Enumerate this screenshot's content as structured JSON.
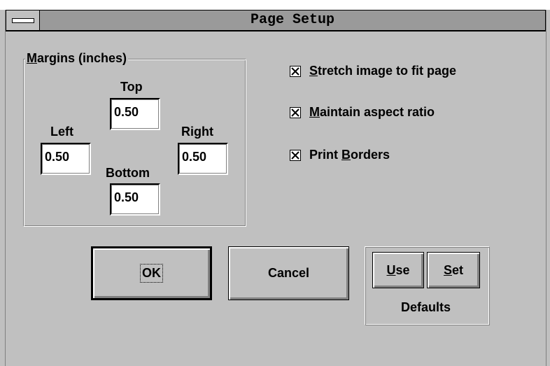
{
  "window": {
    "title": "Page Setup"
  },
  "margins": {
    "group_label": "Margins (inches)",
    "group_label_mnemonic": "M",
    "group_label_rest": "argins (inches)",
    "top": {
      "label": "Top",
      "value": "0.50"
    },
    "left": {
      "label": "Left",
      "value": "0.50"
    },
    "right": {
      "label": "Right",
      "value": "0.50"
    },
    "bottom": {
      "label": "Bottom",
      "value": "0.50"
    }
  },
  "options": [
    {
      "mnemonic": "S",
      "rest": "tretch image to fit page",
      "prefix": "",
      "checked": true
    },
    {
      "mnemonic": "M",
      "rest": "aintain aspect ratio",
      "prefix": "",
      "checked": true
    },
    {
      "mnemonic": "B",
      "rest": "orders",
      "prefix": "Print ",
      "checked": true
    }
  ],
  "buttons": {
    "ok": "OK",
    "cancel": "Cancel",
    "use_mnemonic": "U",
    "use_rest": "se",
    "set_mnemonic": "S",
    "set_rest": "et",
    "defaults_label": "Defaults"
  }
}
